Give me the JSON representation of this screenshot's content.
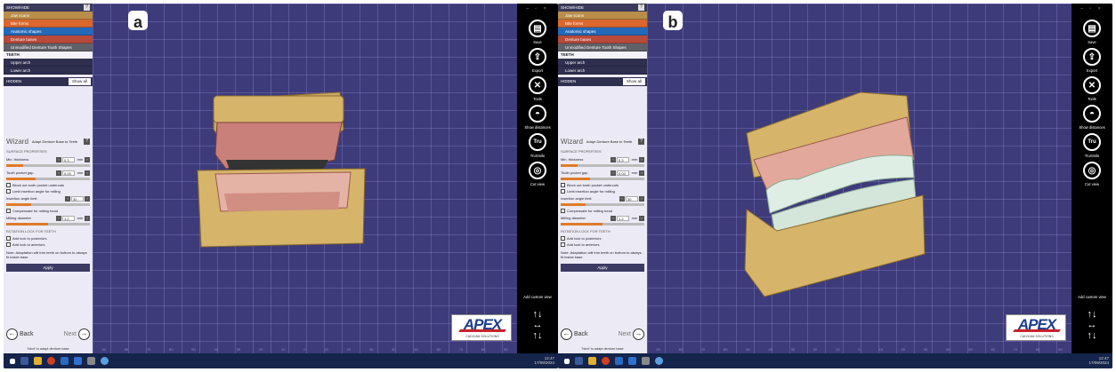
{
  "panels": [
    {
      "badge": "a",
      "showhide": {
        "title": "SHOW/HIDE",
        "help": "?",
        "items": [
          "Jaw scans",
          "Bite forms",
          "Anatomic shapes",
          "Denture bases",
          "Unmodified Denture Tooth Shapes"
        ]
      },
      "teeth": {
        "title": "TEETH",
        "items": [
          "Upper arch",
          "Lower arch"
        ]
      },
      "hidden": {
        "title": "HIDDEN",
        "button": "Show all"
      },
      "wizard": {
        "title": "Wizard",
        "subtitle": "Adapt Denture Base to Teeth",
        "help": "?",
        "section1": "SURFACE PROPERTIES",
        "fields": [
          {
            "label": "Min. thickness",
            "value": "0.3",
            "unit": "mm"
          },
          {
            "label": "Tooth pocket gap",
            "value": "0.03",
            "unit": "mm"
          }
        ],
        "checks": [
          "Block out tooth pocket undercuts",
          "Limit insertion angle for milling"
        ],
        "angle": {
          "label": "Insertion angle limit",
          "value": "30"
        },
        "compensate": "Compensate for milling head",
        "milling": {
          "label": "Milling diameter",
          "value": "1.2",
          "unit": "mm"
        },
        "section2": "ROTATION LOCK FOR TEETH",
        "locks": [
          "Add lock to posteriors",
          "Add lock to anteriors"
        ],
        "note": "Note: Adaptation will trim teeth on bottom to always fit inside base",
        "apply": "Apply",
        "back": "Back",
        "next": "Next",
        "hint": "'Next' to adapt denture base"
      }
    },
    {
      "badge": "b",
      "showhide": {
        "title": "SHOW/HIDE",
        "help": "?",
        "items": [
          "Jaw scans",
          "Bite forms",
          "Anatomic shapes",
          "Denture bases",
          "Unmodified Denture Tooth Shapes"
        ]
      },
      "teeth": {
        "title": "TEETH",
        "items": [
          "Upper arch",
          "Lower arch"
        ]
      },
      "hidden": {
        "title": "HIDDEN",
        "button": "Show all"
      },
      "wizard": {
        "title": "Wizard",
        "subtitle": "Adapt Denture Base to Teeth",
        "help": "?",
        "section1": "SURFACE PROPERTIES",
        "fields": [
          {
            "label": "Min. thickness",
            "value": "0.3",
            "unit": "mm"
          },
          {
            "label": "Tooth pocket gap",
            "value": "0.03",
            "unit": "mm"
          }
        ],
        "checks": [
          "Block out tooth pocket undercuts",
          "Limit insertion angle for milling"
        ],
        "angle": {
          "label": "Insertion angle limit",
          "value": "30"
        },
        "compensate": "Compensate for milling head",
        "milling": {
          "label": "Milling diameter",
          "value": "1.2",
          "unit": "mm"
        },
        "section2": "ROTATION LOCK FOR TEETH",
        "locks": [
          "Add lock to posteriors",
          "Add lock to anteriors"
        ],
        "note": "Note: Adaptation will trim teeth on bottom to always fit inside base",
        "apply": "Apply",
        "back": "Back",
        "next": "Next",
        "hint": "'Next' to adapt denture base"
      }
    }
  ],
  "toolbar": {
    "items": [
      {
        "label": "Save",
        "icon": "save-icon",
        "glyph": "▤"
      },
      {
        "label": "Export",
        "icon": "export-icon",
        "glyph": "⇪"
      },
      {
        "label": "Tools",
        "icon": "tools-icon",
        "glyph": "✕"
      },
      {
        "label": "Show distances",
        "icon": "distances-icon",
        "glyph": "◓"
      },
      {
        "label": "TruSmile",
        "icon": "trusmile-icon",
        "glyph": "Tru"
      },
      {
        "label": "Cut view",
        "icon": "cut-view-icon",
        "glyph": "◎"
      }
    ],
    "custom": "Add custom view"
  },
  "logo": {
    "text": "APEX",
    "subtitle": "CAD/CAM SOLUTIONS"
  },
  "ruler": [
    "90",
    "80",
    "70",
    "60",
    "50",
    "40",
    "30",
    "20",
    "10",
    "0",
    "10",
    "20",
    "30",
    "40",
    "50",
    "60",
    "70",
    "80",
    "90"
  ],
  "taskbar": {
    "time": "12:47",
    "date": "17/09/2024"
  },
  "colors": {
    "viewport": "#3d3b7a",
    "gold": "#b98e4a",
    "orange": "#d9672e",
    "blue": "#2369b8",
    "gum": "#e8a8a0",
    "tooth": "#dfeee4"
  }
}
